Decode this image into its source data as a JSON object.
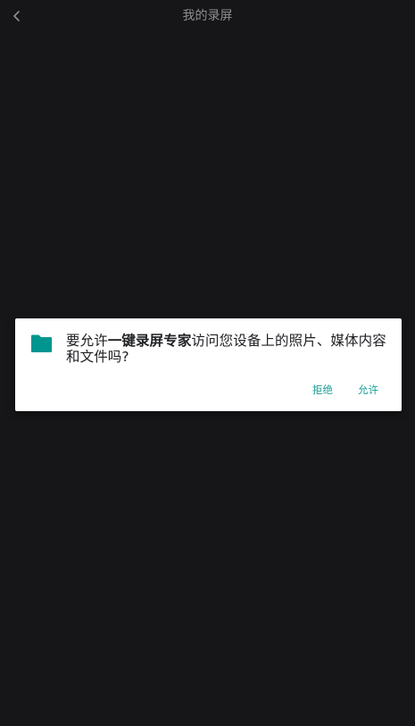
{
  "header": {
    "title": "我的录屏",
    "back_icon": "chevron-left-icon"
  },
  "dialog": {
    "icon": "folder-icon",
    "icon_color": "#00968F",
    "message_prefix": "要允许",
    "app_name": "一键录屏专家",
    "message_suffix": "访问您设备上的照片、媒体内容和文件吗?",
    "deny_label": "拒绝",
    "allow_label": "允许",
    "button_color": "#1A9E98"
  },
  "colors": {
    "background": "#161618",
    "title": "#8E8E92",
    "dialog_bg": "#FFFFFF"
  }
}
